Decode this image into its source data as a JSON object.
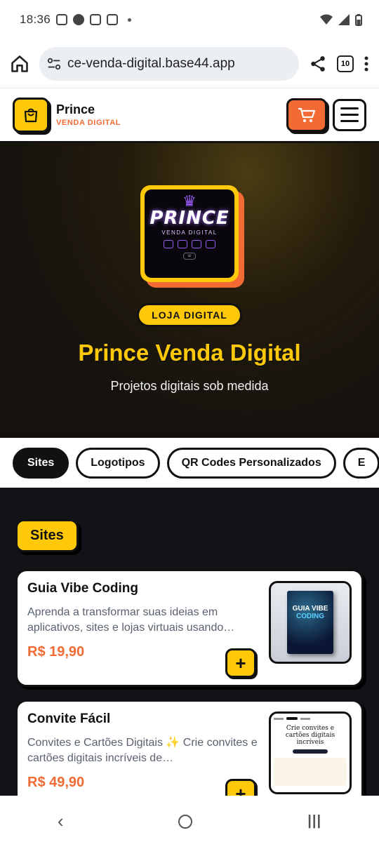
{
  "status": {
    "time": "18:36"
  },
  "browser": {
    "url": "ce-venda-digital.base44.app",
    "tab_count": "10"
  },
  "header": {
    "brand_name": "Prince",
    "brand_sub": "VENDA DIGITAL"
  },
  "hero": {
    "logo_title": "PRINCE",
    "logo_sub": "VENDA DIGITAL",
    "badge": "LOJA DIGITAL",
    "title": "Prince Venda Digital",
    "subtitle": "Projetos digitais sob medida"
  },
  "tabs": [
    {
      "label": "Sites",
      "active": true
    },
    {
      "label": "Logotipos"
    },
    {
      "label": "QR Codes Personalizados"
    },
    {
      "label": "E"
    }
  ],
  "section": {
    "label": "Sites"
  },
  "products": [
    {
      "title": "Guia Vibe Coding",
      "description": "Aprenda a transformar suas ideias em aplicativos, sites e lojas virtuais usando…",
      "price": "R$ 19,90",
      "thumb_title_1": "GUIA VIBE",
      "thumb_title_2": "CODING"
    },
    {
      "title": "Convite Fácil",
      "description": "Convites e Cartões Digitais ✨ Crie convites e cartões digitais incríveis de…",
      "price": "R$ 49,90",
      "thumb_title": "Crie convites e cartões digitais incríveis"
    }
  ],
  "add_label": "+",
  "colors": {
    "accent": "#ffc90a",
    "orange": "#f26b34",
    "dark": "#111318"
  }
}
